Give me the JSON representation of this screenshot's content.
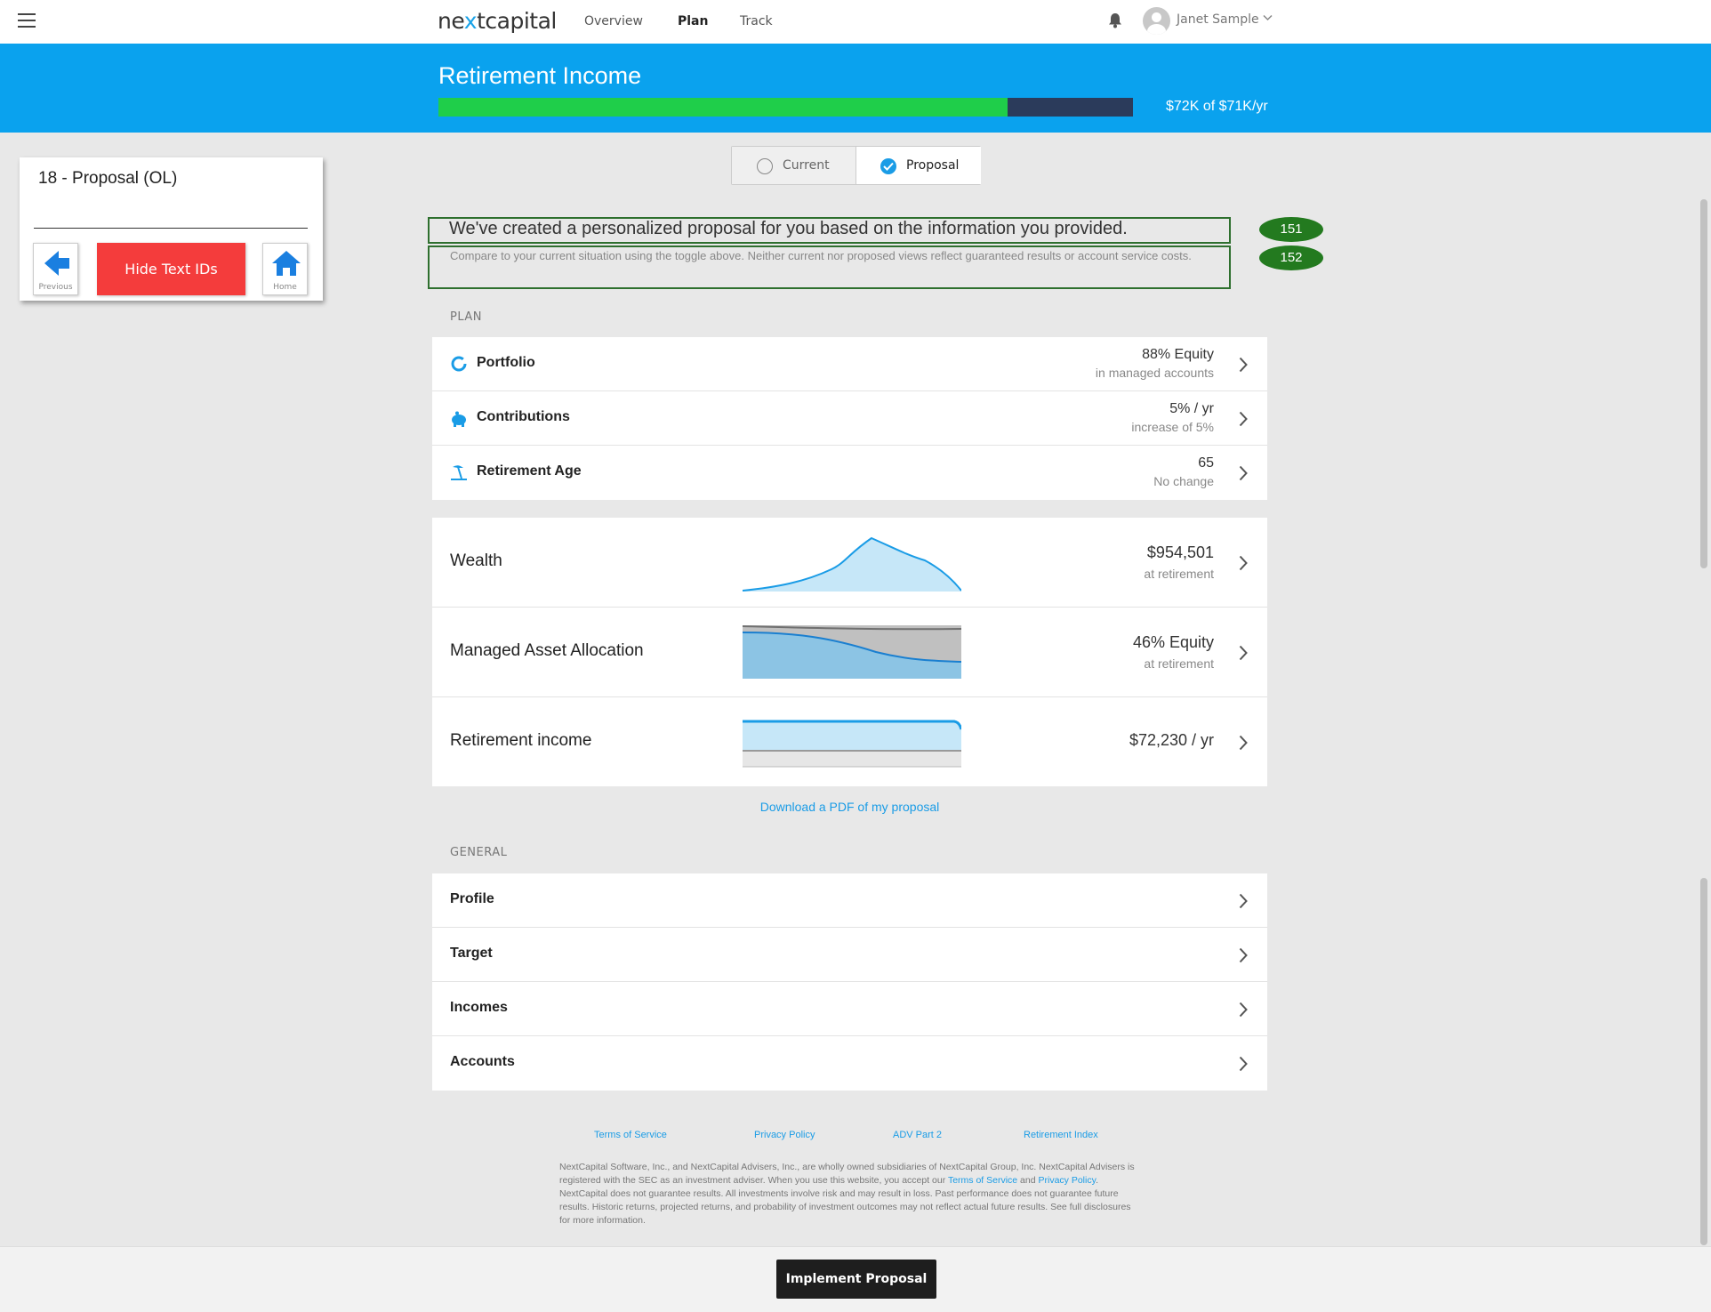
{
  "nav": {
    "logo_pre": "ne",
    "logo_x": "x",
    "logo_post": "tcapital",
    "links": [
      {
        "label": "Overview",
        "active": false
      },
      {
        "label": "Plan",
        "active": true
      },
      {
        "label": "Track",
        "active": false
      }
    ],
    "user_name": "Janet Sample",
    "icons": [
      "menu-icon",
      "bell-icon",
      "avatar",
      "chevron-down-icon"
    ]
  },
  "banner": {
    "title": "Retirement Income",
    "progress_fraction": 0.82,
    "progress_label": "$72K of $71K/yr",
    "bar_color": "#1fce4a",
    "background_color": "#0aa2ee"
  },
  "toggle": {
    "current_label": "Current",
    "proposal_label": "Proposal",
    "selected": "Proposal"
  },
  "side_panel": {
    "title": "18 - Proposal (OL)",
    "previous_label": "Previous",
    "hide_ids_label": "Hide Text IDs",
    "home_label": "Home",
    "hide_button_color": "#f43c3c"
  },
  "intro": {
    "headline": "We've created a personalized proposal for you based on the information you provided.",
    "subtext": "Compare to your current situation using the toggle above. Neither current nor proposed views reflect guaranteed results or account service costs.",
    "headline_id": "151",
    "subtext_id": "152"
  },
  "plan": {
    "section_label": "PLAN",
    "rows": [
      {
        "title": "Portfolio",
        "value": "88% Equity",
        "sub": "in managed accounts",
        "icon": "donut-chart-icon"
      },
      {
        "title": "Contributions",
        "value": "5% / yr",
        "sub": "increase of 5%",
        "icon": "piggy-bank-icon"
      },
      {
        "title": "Retirement Age",
        "value": "65",
        "sub": "No change",
        "icon": "beach-icon"
      }
    ]
  },
  "outcomes": {
    "rows": [
      {
        "title": "Wealth",
        "value": "$954,501",
        "sub": "at retirement",
        "chart": "wealth-area-chart"
      },
      {
        "title": "Managed Asset Allocation",
        "value": "46% Equity",
        "sub": "at retirement",
        "chart": "allocation-area-chart"
      },
      {
        "title": "Retirement income",
        "value": "$72,230 / yr",
        "sub": "",
        "chart": "income-area-chart"
      }
    ],
    "pdf_link": "Download a PDF of my proposal"
  },
  "general": {
    "section_label": "GENERAL",
    "rows": [
      "Profile",
      "Target",
      "Incomes",
      "Accounts"
    ]
  },
  "footer": {
    "links": [
      "Terms of Service",
      "Privacy Policy",
      "ADV Part 2",
      "Retirement Index"
    ],
    "disclaimer_1": "NextCapital Software, Inc., and NextCapital Advisers, Inc., are wholly owned subsidiaries of NextCapital Group, Inc. NextCapital Advisers is registered with the SEC as an investment adviser. When you use this website, you accept our ",
    "disclaimer_tos": "Terms of Service",
    "disclaimer_2": " and ",
    "disclaimer_pp": "Privacy Policy",
    "disclaimer_3": ". NextCapital does not guarantee results. All investments involve risk and may result in loss. Past performance does not guarantee future results. Historic returns, projected returns, and probability of investment outcomes may not reflect actual future results. See full disclosures for more information."
  },
  "bottom_bar": {
    "implement_label": "Implement Proposal"
  },
  "colors": {
    "accent": "#1a9ce6",
    "id_badge": "#237a1f"
  }
}
